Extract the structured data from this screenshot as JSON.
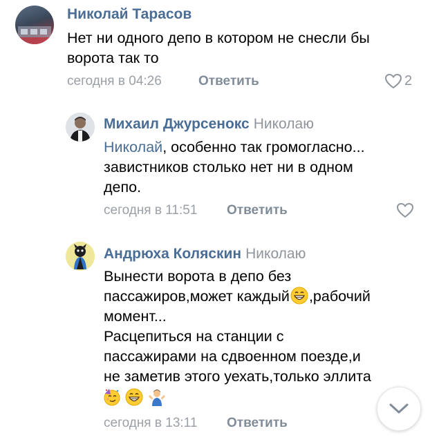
{
  "comments": [
    {
      "author": "Николай Тарасов",
      "lines": [
        "Нет ни одного депо в котором не снесли бы",
        "ворота так то"
      ],
      "time": "сегодня в 04:26",
      "reply_label": "Ответить",
      "likes": "2"
    },
    {
      "author": "Михаил Джурсенокс",
      "reply_to": "Николаю",
      "mention": "Николай",
      "line1_rest": ", особенно так громогласно...",
      "lines": [
        "завистников столько нет ни в одном",
        "депо."
      ],
      "time": "сегодня в 11:51",
      "reply_label": "Ответить"
    },
    {
      "author": "Андрюха Коляскин",
      "reply_to": "Николаю",
      "line1": "Вынести ворота в депо без",
      "line2_a": "пассажиров,может каждый",
      "line2_b": ",рабочий",
      "lines": [
        "момент...",
        "Расцепиться на станции с",
        "пассажирами на сдвоенном поезде,и",
        "не заметив этого уехать,только эллита"
      ],
      "time": "сегодня в 13:11",
      "reply_label": "Ответить"
    }
  ],
  "icons": {
    "like": "heart-icon",
    "scroll": "chevron-down-icon"
  },
  "colors": {
    "link": "#4a6d95",
    "meta": "#9aa0a6",
    "button": "#818c99",
    "text": "#000000"
  }
}
